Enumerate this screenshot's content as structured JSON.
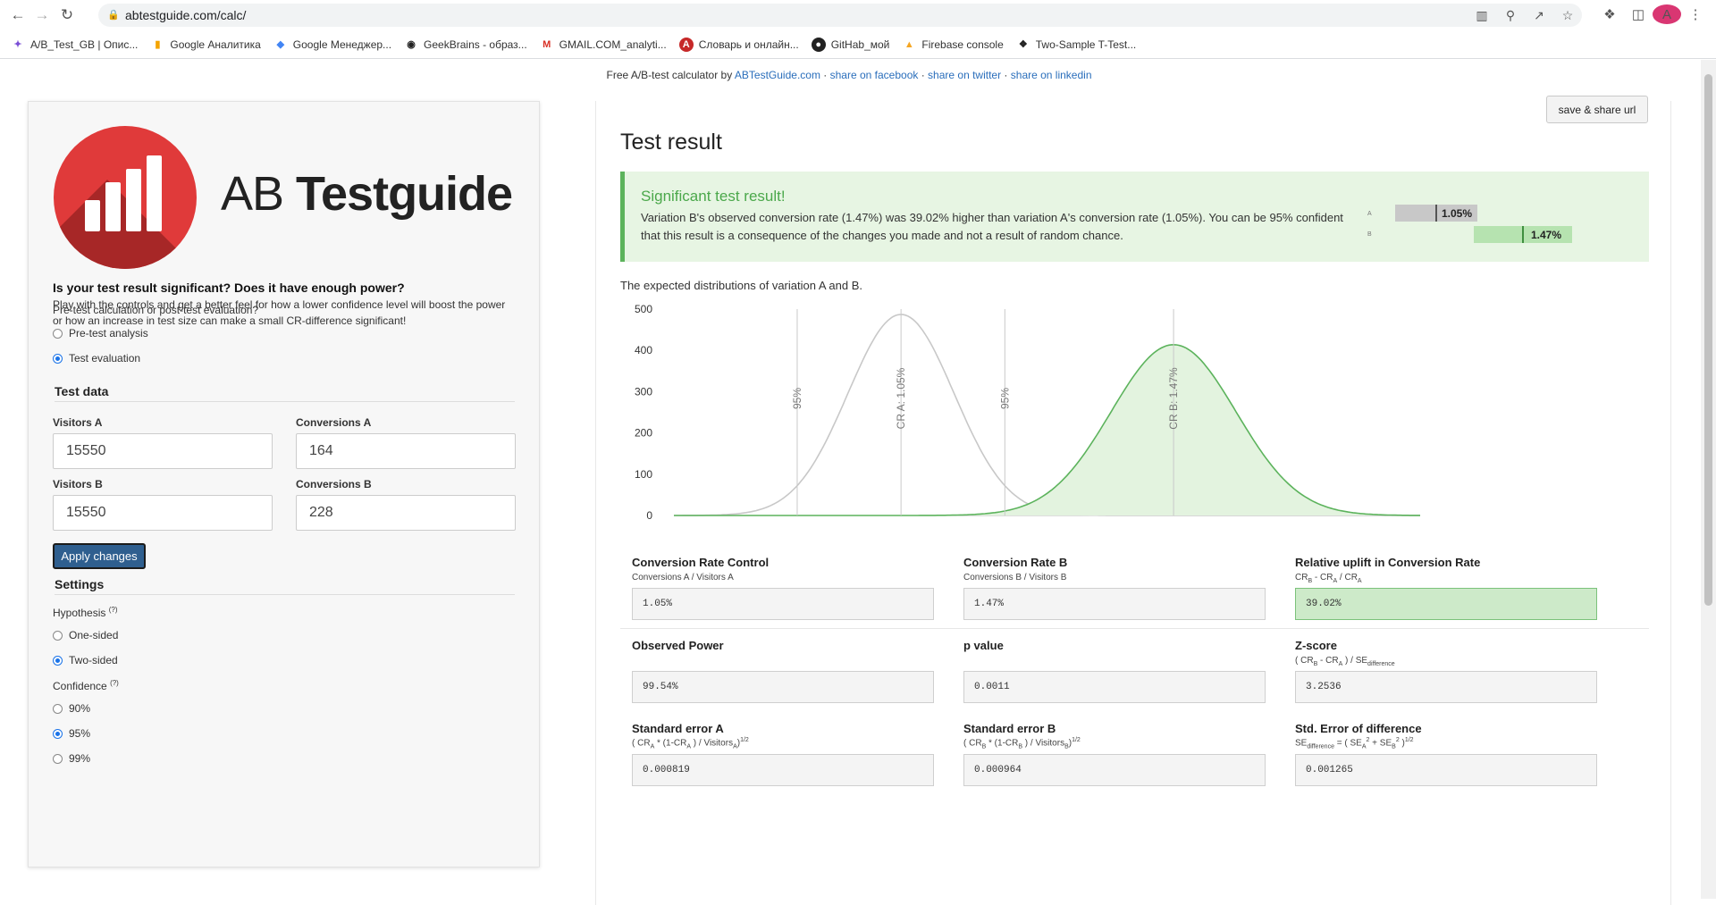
{
  "browser": {
    "url": "abtestguide.com/calc/",
    "avatar_letter": "A",
    "bookmarks": [
      {
        "label": "A/B_Test_GB | Опис...",
        "icon": "jira-icon"
      },
      {
        "label": "Google Аналитика",
        "icon": "analytics-icon"
      },
      {
        "label": "Google Менеджер...",
        "icon": "tag-manager-icon"
      },
      {
        "label": "GeekBrains - образ...",
        "icon": "geekbrains-icon"
      },
      {
        "label": "GMAIL.COM_analyti...",
        "icon": "gmail-icon"
      },
      {
        "label": "Словарь и онлайн...",
        "icon": "dictionary-icon"
      },
      {
        "label": "GitHab_мой",
        "icon": "github-icon"
      },
      {
        "label": "Firebase console",
        "icon": "firebase-icon"
      },
      {
        "label": "Two-Sample T-Test...",
        "icon": "t-test-icon"
      }
    ]
  },
  "credit": {
    "prefix": "Free A/B-test calculator by ",
    "site": "ABTestGuide.com",
    "sep": " · ",
    "facebook": "share on facebook",
    "twitter": "share on twitter",
    "linkedin": "share on linkedin"
  },
  "left": {
    "logo_ab": "AB ",
    "logo_tg": "Testguide",
    "question": "Is your test result significant? Does it have enough power?",
    "description": "Play with the controls and get a better feel for how a lower confidence level will boost the power or how an increase in test size can make a small CR-difference significant!",
    "mode_label": "Pre-test calculation or post-test evaluation?",
    "mode_options": [
      "Pre-test analysis",
      "Test evaluation"
    ],
    "mode_selected": "Test evaluation",
    "test_data_title": "Test data",
    "visitors_a_label": "Visitors A",
    "visitors_a": "15550",
    "conversions_a_label": "Conversions A",
    "conversions_a": "164",
    "visitors_b_label": "Visitors B",
    "visitors_b": "15550",
    "conversions_b_label": "Conversions B",
    "conversions_b": "228",
    "apply_label": "Apply changes",
    "settings_title": "Settings",
    "hypothesis_label": "Hypothesis",
    "help_mark": "(?)",
    "hypothesis_options": [
      "One-sided",
      "Two-sided"
    ],
    "hypothesis_selected": "Two-sided",
    "confidence_label": "Confidence",
    "confidence_options": [
      "90%",
      "95%",
      "99%"
    ],
    "confidence_selected": "95%"
  },
  "right": {
    "share_label": "save & share url",
    "title": "Test result",
    "sig_title": "Significant test result!",
    "sig_text": "Variation B's observed conversion rate (1.47%) was 39.02% higher than variation A's conversion rate (1.05%). You can be 95% confident that this result is a consequence of the changes you made and not a result of random chance.",
    "mini_a_label": "A",
    "mini_a_value": "1.05%",
    "mini_b_label": "B",
    "mini_b_value": "1.47%",
    "dist_label": "The expected distributions of variation A and B."
  },
  "chart_data": {
    "type": "area",
    "y_ticks": [
      0,
      100,
      200,
      300,
      400,
      500
    ],
    "ylim": [
      0,
      500
    ],
    "series": [
      {
        "name": "CR A: 1.05%",
        "mean": 1.05,
        "se": 0.0819,
        "color": "#c8c8c8",
        "filled": false
      },
      {
        "name": "CR B: 1.47%",
        "mean": 1.47,
        "se": 0.0964,
        "color": "#5cb35c",
        "filled": true
      }
    ],
    "vlines": [
      {
        "label": "95%",
        "x": 0.89
      },
      {
        "label": "CR A: 1.05%",
        "x": 1.05
      },
      {
        "label": "95%",
        "x": 1.21
      },
      {
        "label": "CR B: 1.47%",
        "x": 1.47
      }
    ],
    "xlim": [
      0.7,
      1.85
    ]
  },
  "metrics": {
    "cr_control_label": "Conversion Rate Control",
    "cr_control_sub": "Conversions A / Visitors A",
    "cr_control": "1.05%",
    "cr_b_label": "Conversion Rate B",
    "cr_b_sub": "Conversions B / Visitors B",
    "cr_b": "1.47%",
    "uplift_label": "Relative uplift in Conversion Rate",
    "uplift": "39.02%",
    "power_label": "Observed Power",
    "power": "99.54%",
    "p_label": "p value",
    "p": "0.0011",
    "z_label": "Z-score",
    "z": "3.2536",
    "se_a_label": "Standard error A",
    "se_a": "0.000819",
    "se_b_label": "Standard error B",
    "se_b": "0.000964",
    "se_diff_label": "Std. Error of difference",
    "se_diff": "0.001265"
  }
}
